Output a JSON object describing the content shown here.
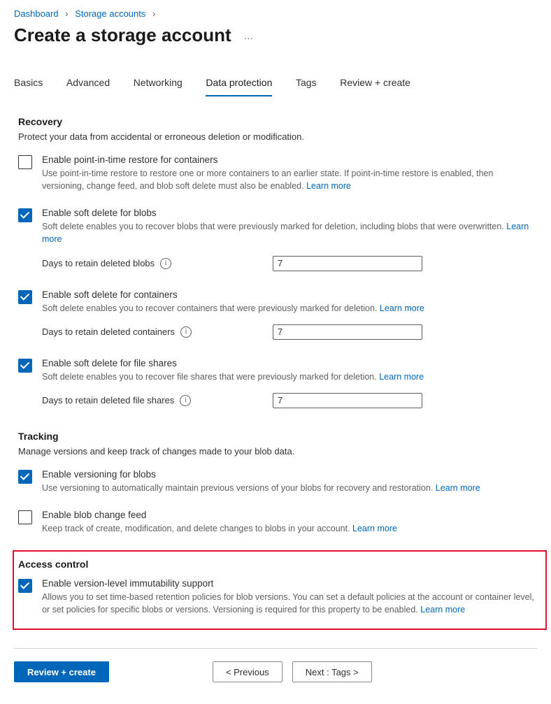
{
  "breadcrumb": {
    "dashboard": "Dashboard",
    "storage_accounts": "Storage accounts"
  },
  "page_title": "Create a storage account",
  "tabs": [
    "Basics",
    "Advanced",
    "Networking",
    "Data protection",
    "Tags",
    "Review + create"
  ],
  "active_tab_index": 3,
  "recovery": {
    "heading": "Recovery",
    "sub": "Protect your data from accidental or erroneous deletion or modification.",
    "pitr": {
      "checked": false,
      "label": "Enable point-in-time restore for containers",
      "desc": "Use point-in-time restore to restore one or more containers to an earlier state. If point-in-time restore is enabled, then versioning, change feed, and blob soft delete must also be enabled.",
      "learn": "Learn more"
    },
    "soft_delete_blobs": {
      "checked": true,
      "label": "Enable soft delete for blobs",
      "desc": "Soft delete enables you to recover blobs that were previously marked for deletion, including blobs that were overwritten.",
      "learn": "Learn more",
      "retain_label": "Days to retain deleted blobs",
      "retain_value": "7"
    },
    "soft_delete_containers": {
      "checked": true,
      "label": "Enable soft delete for containers",
      "desc": "Soft delete enables you to recover containers that were previously marked for deletion.",
      "learn": "Learn more",
      "retain_label": "Days to retain deleted containers",
      "retain_value": "7"
    },
    "soft_delete_fileshares": {
      "checked": true,
      "label": "Enable soft delete for file shares",
      "desc": "Soft delete enables you to recover file shares that were previously marked for deletion.",
      "learn": "Learn more",
      "retain_label": "Days to retain deleted file shares",
      "retain_value": "7"
    }
  },
  "tracking": {
    "heading": "Tracking",
    "sub": "Manage versions and keep track of changes made to your blob data.",
    "versioning": {
      "checked": true,
      "label": "Enable versioning for blobs",
      "desc": "Use versioning to automatically maintain previous versions of your blobs for recovery and restoration.",
      "learn": "Learn more"
    },
    "change_feed": {
      "checked": false,
      "label": "Enable blob change feed",
      "desc": "Keep track of create, modification, and delete changes to blobs in your account.",
      "learn": "Learn more"
    }
  },
  "access_control": {
    "heading": "Access control",
    "immutability": {
      "checked": true,
      "label": "Enable version-level immutability support",
      "desc": "Allows you to set time-based retention policies for blob versions. You can set a default policies at the account or container level, or set policies for specific blobs or versions. Versioning is required for this property to be enabled.",
      "learn": "Learn more"
    }
  },
  "footer": {
    "review": "Review + create",
    "previous": "<  Previous",
    "next": "Next : Tags  >"
  }
}
